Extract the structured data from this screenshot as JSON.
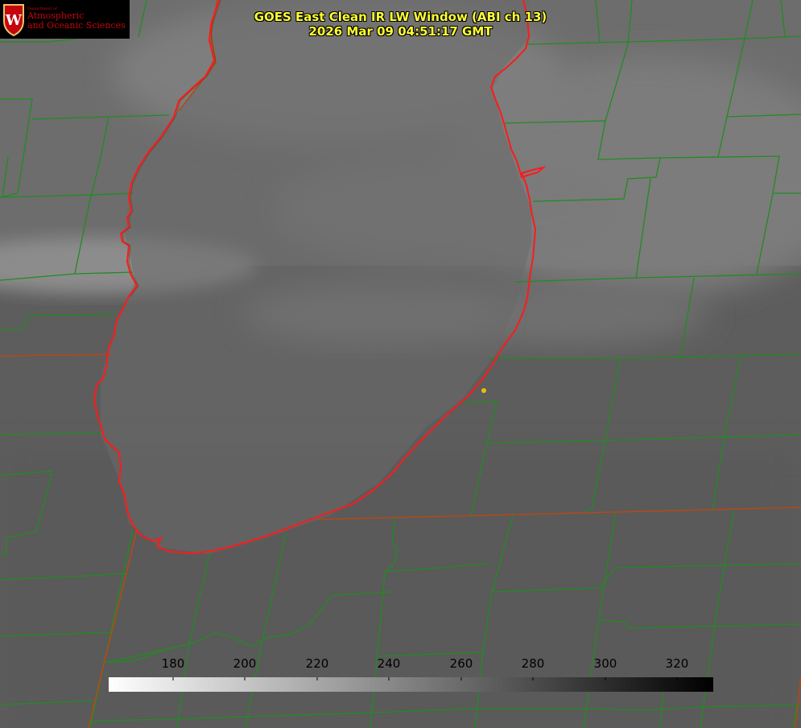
{
  "title": {
    "line1": "GOES East Clean IR LW Window (ABI ch 13)",
    "line2": "2026 Mar 09 04:51:17 GMT"
  },
  "logo": {
    "department": "Department of",
    "line1": "Atmospheric",
    "line2": "and Oceanic Sciences",
    "crest_letter": "W",
    "crest_icon": "uw-crest-icon",
    "color": "#c5050c"
  },
  "colorbar": {
    "orientation": "horizontal",
    "gradient": "white-to-black",
    "range": [
      162,
      330
    ],
    "ticks": [
      "180",
      "200",
      "220",
      "240",
      "260",
      "280",
      "300",
      "320"
    ]
  },
  "colors": {
    "boundary_lines": "#228b22",
    "coastline": "#ff1a1a",
    "state_line": "#b04a1a",
    "title_text": "#ffff33",
    "marker": "#e5c100"
  },
  "map": {
    "projection": "satellite imagery, infrared brightness temperature",
    "water_body_icon": "lake-outline",
    "marker_icon": "location-dot-icon"
  }
}
